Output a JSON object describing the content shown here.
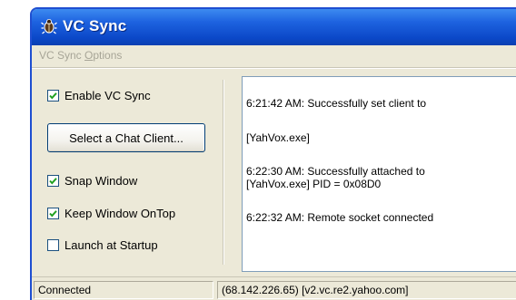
{
  "window": {
    "title": "VC Sync",
    "menu": {
      "prefix": "VC Sync ",
      "access_key": "O",
      "suffix": "ptions"
    }
  },
  "options": {
    "enable": {
      "label": "Enable VC Sync",
      "checked": true
    },
    "select_button_label": "Select a Chat Client...",
    "snap": {
      "label": "Snap Window",
      "checked": true
    },
    "ontop": {
      "label": "Keep Window OnTop",
      "checked": true
    },
    "startup": {
      "label": "Launch at Startup",
      "checked": false
    }
  },
  "log": {
    "lines": [
      "6:21:42 AM: Successfully set client to",
      "[YahVox.exe]",
      "6:22:30 AM: Successfully attached to",
      "[YahVox.exe] PID = 0x08D0",
      "6:22:32 AM: Remote socket connected"
    ]
  },
  "status": {
    "connection": "Connected",
    "server": "(68.142.226.65) [v2.vc.re2.yahoo.com]"
  },
  "colors": {
    "titlebar": "#0b48c8",
    "window_face": "#ece9d8",
    "check_mark": "#21a121"
  },
  "icons": {
    "app": "bug-icon",
    "check": "check-mark-icon"
  }
}
